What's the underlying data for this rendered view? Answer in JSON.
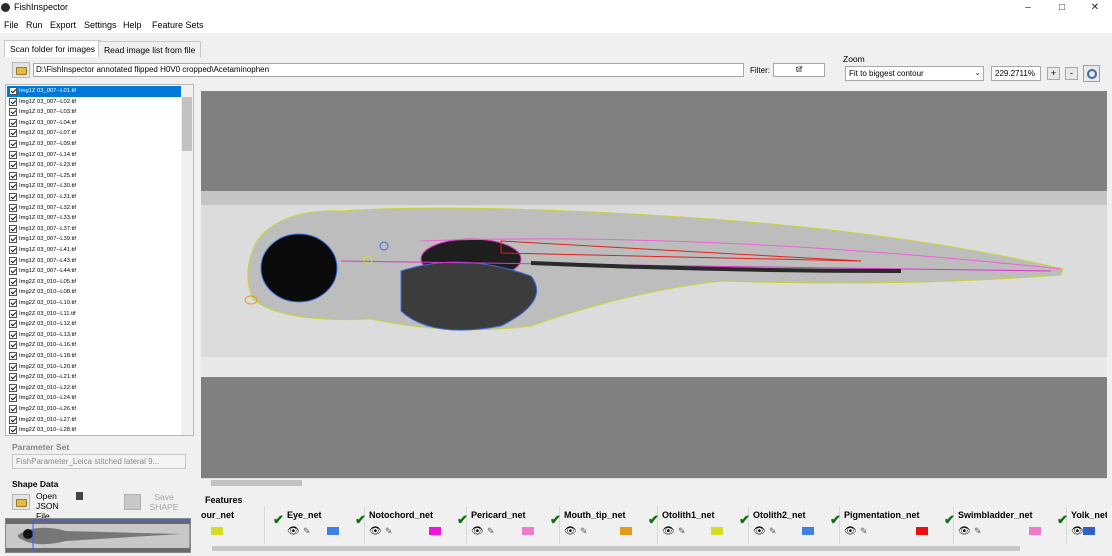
{
  "window": {
    "title": "FishInspector",
    "minimize": "–",
    "maximize": "□",
    "close": "✕"
  },
  "menu": [
    "File",
    "Run",
    "Export",
    "Settings",
    "Help",
    "Feature Sets"
  ],
  "tabs": [
    "Scan folder for images",
    "Read image list from file"
  ],
  "path": "D:\\FishInspector annotated flipped H0V0 cropped\\Acetaminophen",
  "filter": {
    "label": "Filter:",
    "value": "tif"
  },
  "zoom": {
    "label": "Zoom",
    "mode": "Fit to biggest contour",
    "value": "229.2711%",
    "plus": "+",
    "minus": "-"
  },
  "files": [
    "Img1Z 03_007--L01.tif",
    "Img1Z 03_007--L02.tif",
    "Img1Z 03_007--L03.tif",
    "Img1Z 03_007--L04.tif",
    "Img1Z 03_007--L07.tif",
    "Img1Z 03_007--L09.tif",
    "Img1Z 03_007--L14.tif",
    "Img1Z 03_007--L23.tif",
    "Img1Z 03_007--L25.tif",
    "Img1Z 03_007--L30.tif",
    "Img1Z 03_007--L31.tif",
    "Img1Z 03_007--L32.tif",
    "Img1Z 03_007--L33.tif",
    "Img1Z 03_007--L37.tif",
    "Img1Z 03_007--L39.tif",
    "Img1Z 03_007--L41.tif",
    "Img1Z 03_007--L43.tif",
    "Img1Z 03_007--L44.tif",
    "Img2Z 03_010--L05.tif",
    "Img2Z 03_010--L08.tif",
    "Img2Z 03_010--L10.tif",
    "Img2Z 03_010--L11.tif",
    "Img2Z 03_010--L12.tif",
    "Img2Z 03_010--L13.tif",
    "Img2Z 03_010--L16.tif",
    "Img2Z 03_010--L18.tif",
    "Img2Z 03_010--L20.tif",
    "Img2Z 03_010--L21.tif",
    "Img2Z 03_010--L22.tif",
    "Img2Z 03_010--L24.tif",
    "Img2Z 03_010--L26.tif",
    "Img2Z 03_010--L27.tif",
    "Img2Z 03_010--L28.tif"
  ],
  "param_set": {
    "label": "Parameter Set",
    "value": "FishParameter_Leica stitched lateral 9..."
  },
  "shape": {
    "label": "Shape Data",
    "open": "Open JSON File",
    "save": "Save SHAPE"
  },
  "features_label": "Features",
  "features": [
    {
      "name": "our_net",
      "color": "#d4dc26",
      "check": ""
    },
    {
      "name": "Eye_net",
      "color": "#3f7fe8",
      "check": "✔"
    },
    {
      "name": "Notochord_net",
      "color": "#f016d8",
      "check": "✔"
    },
    {
      "name": "Pericard_net",
      "color": "#ee7cc8",
      "check": "✔"
    },
    {
      "name": "Mouth_tip_net",
      "color": "#e59a1c",
      "check": "✔"
    },
    {
      "name": "Otolith1_net",
      "color": "#d4dc26",
      "check": "✔"
    },
    {
      "name": "Otolith2_net",
      "color": "#3f7fe8",
      "check": "✔"
    },
    {
      "name": "Pigmentation_net",
      "color": "#e81010",
      "check": "✔"
    },
    {
      "name": "Swimbladder_net",
      "color": "#ee7cc8",
      "check": "✔"
    },
    {
      "name": "Yolk_net",
      "color": "#2864e0",
      "check": "✔"
    }
  ],
  "icons": {
    "eye": "👁",
    "pen": "✎"
  }
}
